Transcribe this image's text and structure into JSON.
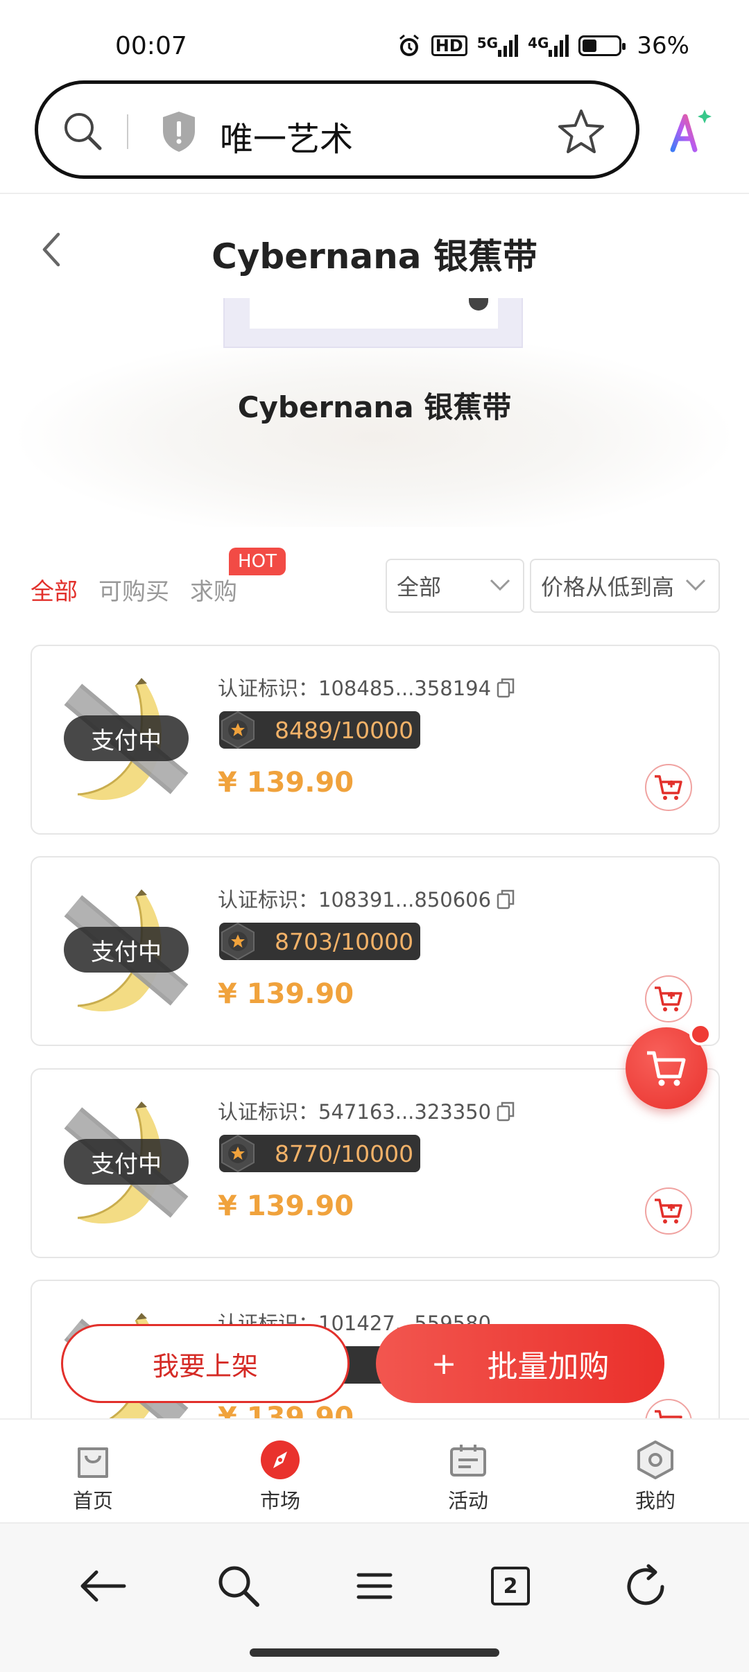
{
  "status_bar": {
    "time": "00:07",
    "hd_label": "HD",
    "net_5g": "5G",
    "net_4g": "4G",
    "battery_percent": "36%"
  },
  "browser": {
    "url_text": "唯一艺术",
    "tab_count": "2"
  },
  "header": {
    "title": "Cybernana 银蕉带"
  },
  "hero": {
    "title": "Cybernana 银蕉带"
  },
  "filters": {
    "tabs": [
      {
        "label": "全部",
        "active": true
      },
      {
        "label": "可购买",
        "active": false
      },
      {
        "label": "求购",
        "active": false
      }
    ],
    "hot_badge": "HOT",
    "category_select": "全部",
    "sort_select": "价格从低到高"
  },
  "listings": [
    {
      "status": "支付中",
      "cert_label": "认证标识：",
      "cert_id": "108485...358194",
      "edition": "8489/10000",
      "price": "¥ 139.90"
    },
    {
      "status": "支付中",
      "cert_label": "认证标识：",
      "cert_id": "108391...850606",
      "edition": "8703/10000",
      "price": "¥ 139.90"
    },
    {
      "status": "支付中",
      "cert_label": "认证标识：",
      "cert_id": "547163...323350",
      "edition": "8770/10000",
      "price": "¥ 139.90"
    },
    {
      "status": "",
      "cert_label": "认证标识：",
      "cert_id": "101427...559580",
      "edition": "",
      "price": "¥ 139.90"
    }
  ],
  "actions": {
    "list_button": "我要上架",
    "batch_plus": "+",
    "batch_button": "批量加购"
  },
  "app_nav": [
    {
      "label": "首页",
      "icon": "bag-icon"
    },
    {
      "label": "市场",
      "icon": "compass-icon"
    },
    {
      "label": "活动",
      "icon": "calendar-icon"
    },
    {
      "label": "我的",
      "icon": "hexagon-icon"
    }
  ],
  "colors": {
    "accent_red": "#e2302b",
    "price_orange": "#f0a23c"
  }
}
